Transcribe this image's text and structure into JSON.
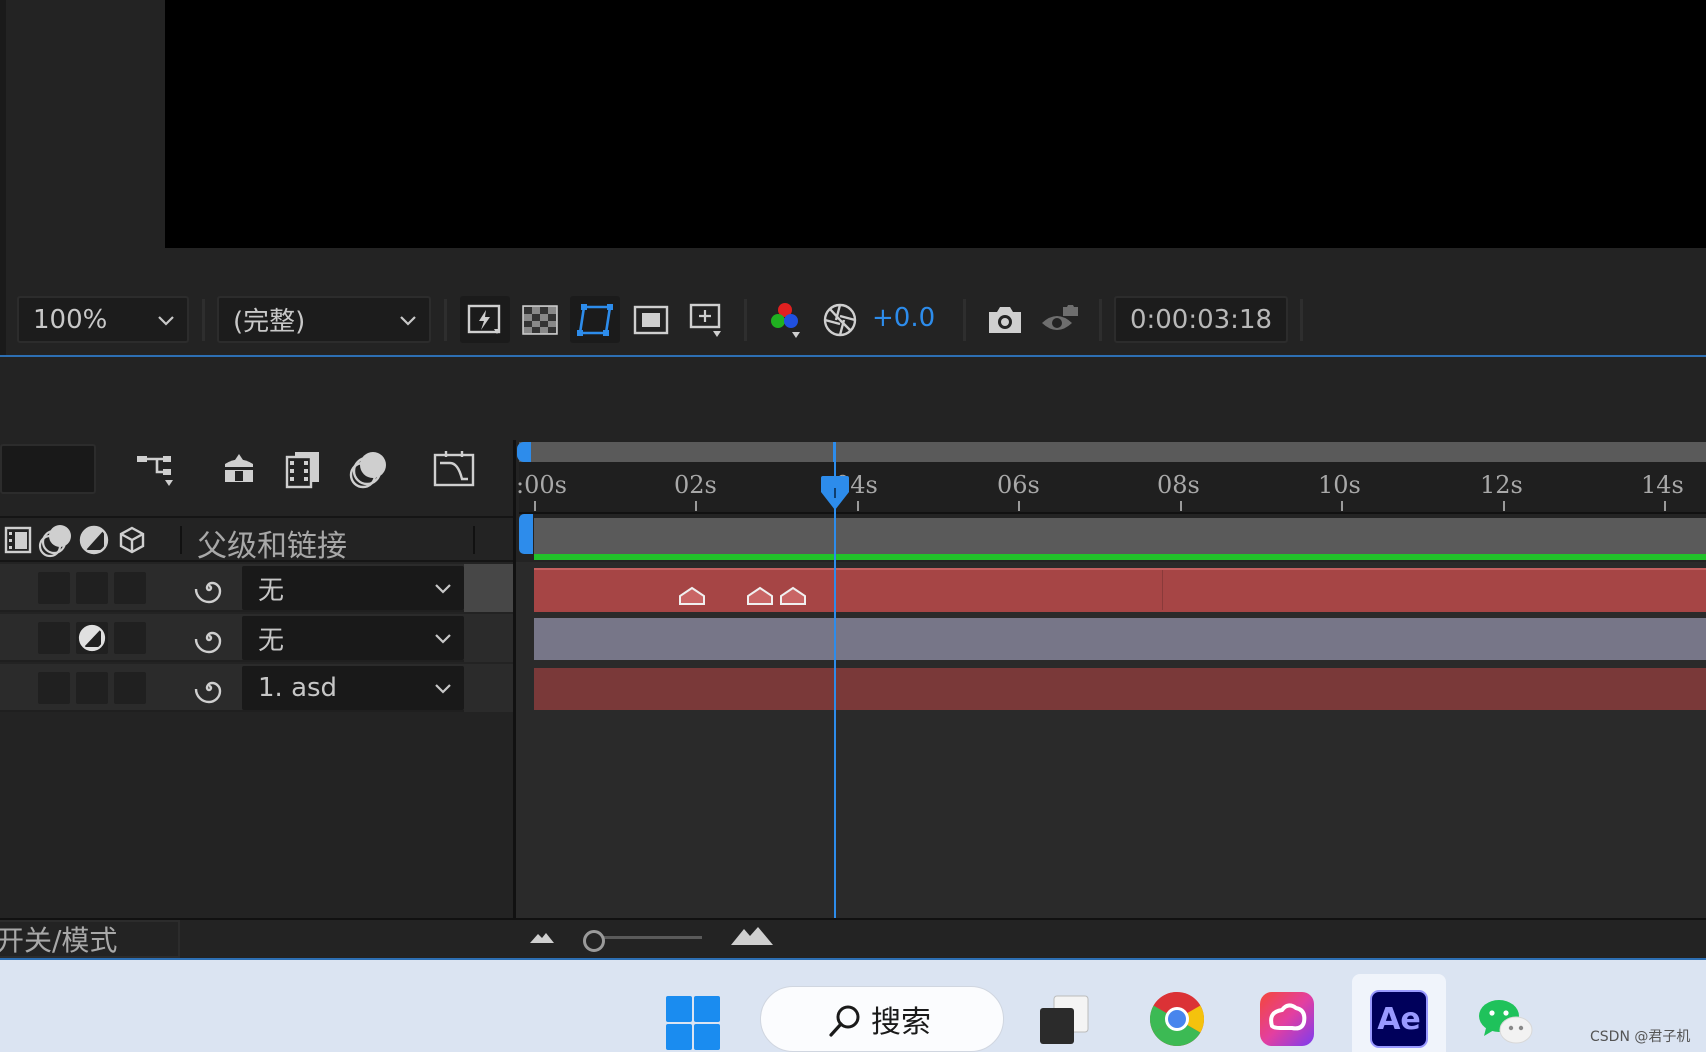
{
  "viewer": {
    "zoom": "100%",
    "resolution": "(完整)",
    "exposure": "+0.0",
    "timecode": "0:00:03:18"
  },
  "timeline": {
    "column_header": "父级和链接",
    "ruler_labels": [
      ":00s",
      "02s",
      "04s",
      "06s",
      "08s",
      "10s",
      "12s",
      "14s"
    ],
    "playhead_time": "0:00:03:18",
    "layers": [
      {
        "parent": "无",
        "bar_color": "#a64545"
      },
      {
        "parent": "无",
        "bar_color": "#777688"
      },
      {
        "parent": "1. asd",
        "bar_color": "#7a3939"
      }
    ],
    "footer_mode": "开关/模式"
  },
  "taskbar": {
    "search_label": "搜索",
    "apps": [
      "windows-start",
      "task-view",
      "chrome",
      "creative-cloud",
      "after-effects",
      "wechat"
    ],
    "ae_label": "Ae"
  },
  "watermark": "CSDN @君子机",
  "colors": {
    "accent": "#2d8ceb",
    "work_area_green": "#22c22a"
  }
}
